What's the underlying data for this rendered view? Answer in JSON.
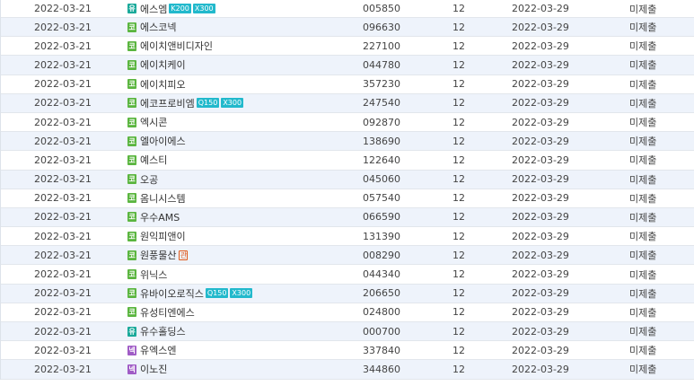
{
  "rows": [
    {
      "date": "2022-03-21",
      "market": "유",
      "name": "에스엠",
      "tags": [
        "K200",
        "X300"
      ],
      "warn": "",
      "code": "005850",
      "qty": "12",
      "due": "2022-03-29",
      "status": "미제출"
    },
    {
      "date": "2022-03-21",
      "market": "코",
      "name": "에스코넥",
      "tags": [],
      "warn": "",
      "code": "096630",
      "qty": "12",
      "due": "2022-03-29",
      "status": "미제출"
    },
    {
      "date": "2022-03-21",
      "market": "코",
      "name": "에이치앤비디자인",
      "tags": [],
      "warn": "",
      "code": "227100",
      "qty": "12",
      "due": "2022-03-29",
      "status": "미제출"
    },
    {
      "date": "2022-03-21",
      "market": "코",
      "name": "에이치케이",
      "tags": [],
      "warn": "",
      "code": "044780",
      "qty": "12",
      "due": "2022-03-29",
      "status": "미제출"
    },
    {
      "date": "2022-03-21",
      "market": "코",
      "name": "에이치피오",
      "tags": [],
      "warn": "",
      "code": "357230",
      "qty": "12",
      "due": "2022-03-29",
      "status": "미제출"
    },
    {
      "date": "2022-03-21",
      "market": "코",
      "name": "에코프로비엠",
      "tags": [
        "Q150",
        "X300"
      ],
      "warn": "",
      "code": "247540",
      "qty": "12",
      "due": "2022-03-29",
      "status": "미제출"
    },
    {
      "date": "2022-03-21",
      "market": "코",
      "name": "엑시콘",
      "tags": [],
      "warn": "",
      "code": "092870",
      "qty": "12",
      "due": "2022-03-29",
      "status": "미제출"
    },
    {
      "date": "2022-03-21",
      "market": "코",
      "name": "엘아이에스",
      "tags": [],
      "warn": "",
      "code": "138690",
      "qty": "12",
      "due": "2022-03-29",
      "status": "미제출"
    },
    {
      "date": "2022-03-21",
      "market": "코",
      "name": "예스티",
      "tags": [],
      "warn": "",
      "code": "122640",
      "qty": "12",
      "due": "2022-03-29",
      "status": "미제출"
    },
    {
      "date": "2022-03-21",
      "market": "코",
      "name": "오공",
      "tags": [],
      "warn": "",
      "code": "045060",
      "qty": "12",
      "due": "2022-03-29",
      "status": "미제출"
    },
    {
      "date": "2022-03-21",
      "market": "코",
      "name": "옴니시스템",
      "tags": [],
      "warn": "",
      "code": "057540",
      "qty": "12",
      "due": "2022-03-29",
      "status": "미제출"
    },
    {
      "date": "2022-03-21",
      "market": "코",
      "name": "우수AMS",
      "tags": [],
      "warn": "",
      "code": "066590",
      "qty": "12",
      "due": "2022-03-29",
      "status": "미제출"
    },
    {
      "date": "2022-03-21",
      "market": "코",
      "name": "원익피앤이",
      "tags": [],
      "warn": "",
      "code": "131390",
      "qty": "12",
      "due": "2022-03-29",
      "status": "미제출"
    },
    {
      "date": "2022-03-21",
      "market": "코",
      "name": "원풍물산",
      "tags": [],
      "warn": "관",
      "code": "008290",
      "qty": "12",
      "due": "2022-03-29",
      "status": "미제출"
    },
    {
      "date": "2022-03-21",
      "market": "코",
      "name": "위닉스",
      "tags": [],
      "warn": "",
      "code": "044340",
      "qty": "12",
      "due": "2022-03-29",
      "status": "미제출"
    },
    {
      "date": "2022-03-21",
      "market": "코",
      "name": "유바이오로직스",
      "tags": [
        "Q150",
        "X300"
      ],
      "warn": "",
      "code": "206650",
      "qty": "12",
      "due": "2022-03-29",
      "status": "미제출"
    },
    {
      "date": "2022-03-21",
      "market": "코",
      "name": "유성티엔에스",
      "tags": [],
      "warn": "",
      "code": "024800",
      "qty": "12",
      "due": "2022-03-29",
      "status": "미제출"
    },
    {
      "date": "2022-03-21",
      "market": "유",
      "name": "유수홀딩스",
      "tags": [],
      "warn": "",
      "code": "000700",
      "qty": "12",
      "due": "2022-03-29",
      "status": "미제출"
    },
    {
      "date": "2022-03-21",
      "market": "넥",
      "name": "유엑스엔",
      "tags": [],
      "warn": "",
      "code": "337840",
      "qty": "12",
      "due": "2022-03-29",
      "status": "미제출"
    },
    {
      "date": "2022-03-21",
      "market": "넥",
      "name": "이노진",
      "tags": [],
      "warn": "",
      "code": "344860",
      "qty": "12",
      "due": "2022-03-29",
      "status": "미제출"
    }
  ],
  "market_colors": {
    "유": "#1aa99a",
    "코": "#5ab53f",
    "넥": "#a05cc6"
  }
}
